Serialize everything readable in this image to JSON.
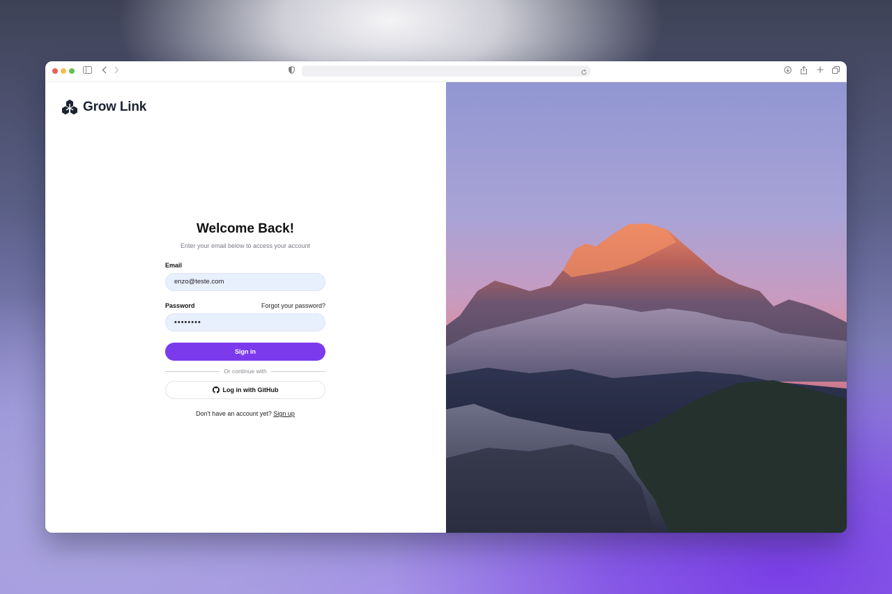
{
  "browser": {
    "icons": [
      "sidebar-icon",
      "back-icon",
      "forward-icon",
      "shield-icon",
      "reload-icon",
      "download-icon",
      "share-icon",
      "new-tab-icon",
      "tabs-icon"
    ]
  },
  "brand": {
    "name": "Grow Link"
  },
  "form": {
    "title": "Welcome Back!",
    "subtitle": "Enter your email below to access your account",
    "email_label": "Email",
    "email_value": "enzo@teste.com",
    "password_label": "Password",
    "forgot_label": "Forgot your password?",
    "password_value": "••••••••",
    "signin_label": "Sign in",
    "divider_label": "Or continue with",
    "github_label": "Log in with GitHub",
    "signup_prompt": "Don't have an account yet?",
    "signup_link": "Sign up"
  },
  "colors": {
    "accent": "#7c3aed",
    "input_bg": "#e8effd",
    "brand_text": "#1c2331"
  }
}
